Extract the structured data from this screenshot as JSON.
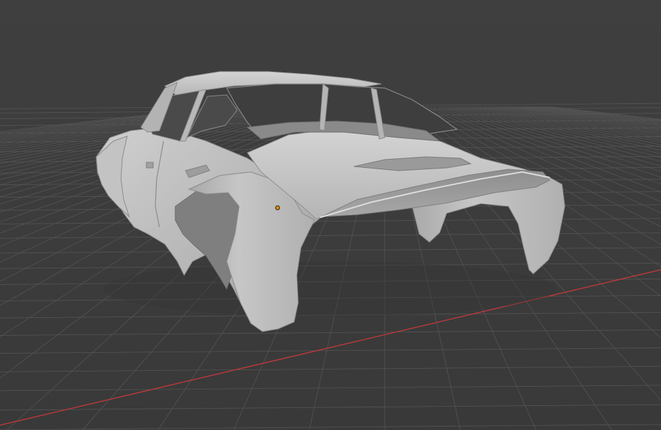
{
  "viewport": {
    "background_color": "#3d3d3d",
    "grid_color": "#555555",
    "x_axis_color": "#c0393b",
    "origin_color": "#e08a00"
  },
  "model": {
    "description": "car-body-shell",
    "body_color": "#b8b8b8",
    "shadow_color": "#8e8e8e",
    "highlight_color": "#d2d2d2"
  }
}
